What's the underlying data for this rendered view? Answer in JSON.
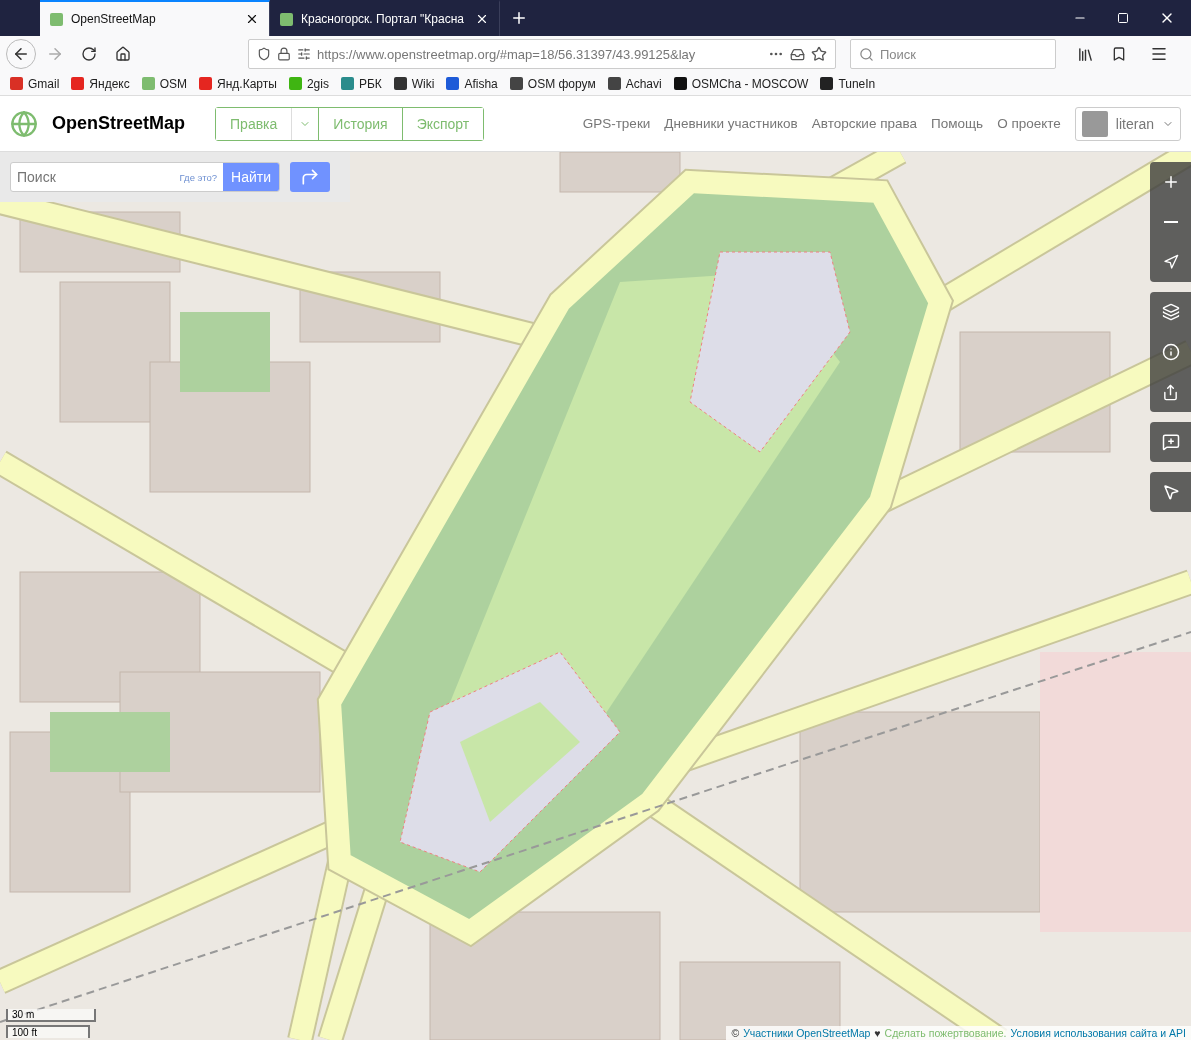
{
  "browser": {
    "tabs": [
      {
        "title": "OpenStreetMap",
        "selected": true
      },
      {
        "title": "Красногорск. Портал \"Красна",
        "selected": false
      }
    ],
    "url": "https://www.openstreetmap.org/#map=18/56.31397/43.99125&lay",
    "search": {
      "placeholder": "Поиск"
    },
    "bookmarks": [
      {
        "label": "Gmail",
        "color": "#d93025"
      },
      {
        "label": "Яндекс",
        "color": "#e52620"
      },
      {
        "label": "OSM",
        "color": "#7ebc6f"
      },
      {
        "label": "Янд.Карты",
        "color": "#e52620"
      },
      {
        "label": "2gis",
        "color": "#3fb512"
      },
      {
        "label": "РБК",
        "color": "#2a8c8c"
      },
      {
        "label": "Wiki",
        "color": "#333333"
      },
      {
        "label": "Afisha",
        "color": "#1e5bd8"
      },
      {
        "label": "OSM форум",
        "color": "#444444"
      },
      {
        "label": "Achavi",
        "color": "#444444"
      },
      {
        "label": "OSMCha - MOSCOW",
        "color": "#111111"
      },
      {
        "label": "TuneIn",
        "color": "#222222"
      }
    ]
  },
  "osm": {
    "brand": "OpenStreetMap",
    "edit_buttons": [
      {
        "label": "Правка",
        "kind": "dropdown"
      },
      {
        "label": "История",
        "kind": "plain"
      },
      {
        "label": "Экспорт",
        "kind": "plain"
      }
    ],
    "nav": [
      "GPS-треки",
      "Дневники участников",
      "Авторские права",
      "Помощь",
      "О проекте"
    ],
    "user": "literan",
    "search": {
      "placeholder": "Поиск",
      "where": "Где это?",
      "go": "Найти"
    },
    "scale": [
      "30 m",
      "100 ft"
    ],
    "attribution": {
      "prefix": "©",
      "links": [
        "Участники OpenStreetMap",
        "Сделать пожертвование.",
        "Условия использования сайта и API"
      ],
      "heart": "♥"
    }
  }
}
